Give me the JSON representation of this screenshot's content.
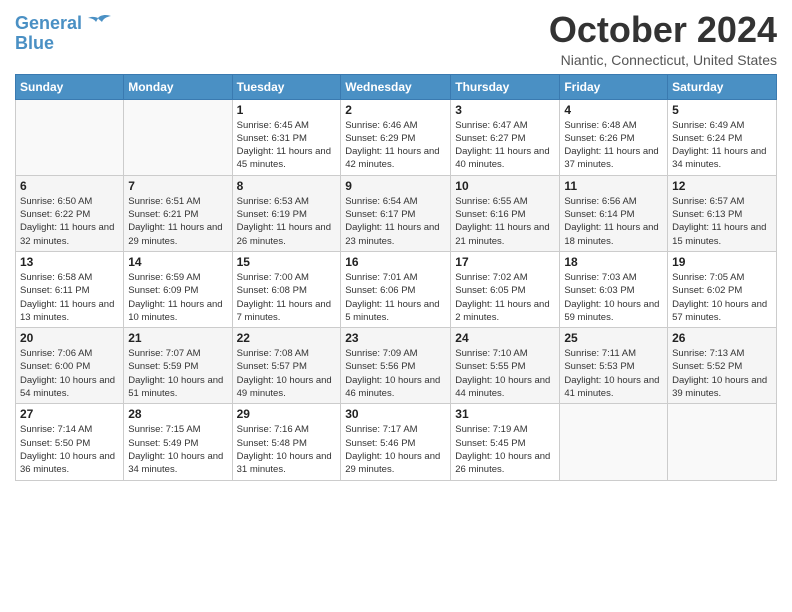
{
  "header": {
    "logo_line1": "General",
    "logo_line2": "Blue",
    "month_title": "October 2024",
    "location": "Niantic, Connecticut, United States"
  },
  "days_of_week": [
    "Sunday",
    "Monday",
    "Tuesday",
    "Wednesday",
    "Thursday",
    "Friday",
    "Saturday"
  ],
  "weeks": [
    [
      {
        "day": "",
        "info": ""
      },
      {
        "day": "",
        "info": ""
      },
      {
        "day": "1",
        "info": "Sunrise: 6:45 AM\nSunset: 6:31 PM\nDaylight: 11 hours and 45 minutes."
      },
      {
        "day": "2",
        "info": "Sunrise: 6:46 AM\nSunset: 6:29 PM\nDaylight: 11 hours and 42 minutes."
      },
      {
        "day": "3",
        "info": "Sunrise: 6:47 AM\nSunset: 6:27 PM\nDaylight: 11 hours and 40 minutes."
      },
      {
        "day": "4",
        "info": "Sunrise: 6:48 AM\nSunset: 6:26 PM\nDaylight: 11 hours and 37 minutes."
      },
      {
        "day": "5",
        "info": "Sunrise: 6:49 AM\nSunset: 6:24 PM\nDaylight: 11 hours and 34 minutes."
      }
    ],
    [
      {
        "day": "6",
        "info": "Sunrise: 6:50 AM\nSunset: 6:22 PM\nDaylight: 11 hours and 32 minutes."
      },
      {
        "day": "7",
        "info": "Sunrise: 6:51 AM\nSunset: 6:21 PM\nDaylight: 11 hours and 29 minutes."
      },
      {
        "day": "8",
        "info": "Sunrise: 6:53 AM\nSunset: 6:19 PM\nDaylight: 11 hours and 26 minutes."
      },
      {
        "day": "9",
        "info": "Sunrise: 6:54 AM\nSunset: 6:17 PM\nDaylight: 11 hours and 23 minutes."
      },
      {
        "day": "10",
        "info": "Sunrise: 6:55 AM\nSunset: 6:16 PM\nDaylight: 11 hours and 21 minutes."
      },
      {
        "day": "11",
        "info": "Sunrise: 6:56 AM\nSunset: 6:14 PM\nDaylight: 11 hours and 18 minutes."
      },
      {
        "day": "12",
        "info": "Sunrise: 6:57 AM\nSunset: 6:13 PM\nDaylight: 11 hours and 15 minutes."
      }
    ],
    [
      {
        "day": "13",
        "info": "Sunrise: 6:58 AM\nSunset: 6:11 PM\nDaylight: 11 hours and 13 minutes."
      },
      {
        "day": "14",
        "info": "Sunrise: 6:59 AM\nSunset: 6:09 PM\nDaylight: 11 hours and 10 minutes."
      },
      {
        "day": "15",
        "info": "Sunrise: 7:00 AM\nSunset: 6:08 PM\nDaylight: 11 hours and 7 minutes."
      },
      {
        "day": "16",
        "info": "Sunrise: 7:01 AM\nSunset: 6:06 PM\nDaylight: 11 hours and 5 minutes."
      },
      {
        "day": "17",
        "info": "Sunrise: 7:02 AM\nSunset: 6:05 PM\nDaylight: 11 hours and 2 minutes."
      },
      {
        "day": "18",
        "info": "Sunrise: 7:03 AM\nSunset: 6:03 PM\nDaylight: 10 hours and 59 minutes."
      },
      {
        "day": "19",
        "info": "Sunrise: 7:05 AM\nSunset: 6:02 PM\nDaylight: 10 hours and 57 minutes."
      }
    ],
    [
      {
        "day": "20",
        "info": "Sunrise: 7:06 AM\nSunset: 6:00 PM\nDaylight: 10 hours and 54 minutes."
      },
      {
        "day": "21",
        "info": "Sunrise: 7:07 AM\nSunset: 5:59 PM\nDaylight: 10 hours and 51 minutes."
      },
      {
        "day": "22",
        "info": "Sunrise: 7:08 AM\nSunset: 5:57 PM\nDaylight: 10 hours and 49 minutes."
      },
      {
        "day": "23",
        "info": "Sunrise: 7:09 AM\nSunset: 5:56 PM\nDaylight: 10 hours and 46 minutes."
      },
      {
        "day": "24",
        "info": "Sunrise: 7:10 AM\nSunset: 5:55 PM\nDaylight: 10 hours and 44 minutes."
      },
      {
        "day": "25",
        "info": "Sunrise: 7:11 AM\nSunset: 5:53 PM\nDaylight: 10 hours and 41 minutes."
      },
      {
        "day": "26",
        "info": "Sunrise: 7:13 AM\nSunset: 5:52 PM\nDaylight: 10 hours and 39 minutes."
      }
    ],
    [
      {
        "day": "27",
        "info": "Sunrise: 7:14 AM\nSunset: 5:50 PM\nDaylight: 10 hours and 36 minutes."
      },
      {
        "day": "28",
        "info": "Sunrise: 7:15 AM\nSunset: 5:49 PM\nDaylight: 10 hours and 34 minutes."
      },
      {
        "day": "29",
        "info": "Sunrise: 7:16 AM\nSunset: 5:48 PM\nDaylight: 10 hours and 31 minutes."
      },
      {
        "day": "30",
        "info": "Sunrise: 7:17 AM\nSunset: 5:46 PM\nDaylight: 10 hours and 29 minutes."
      },
      {
        "day": "31",
        "info": "Sunrise: 7:19 AM\nSunset: 5:45 PM\nDaylight: 10 hours and 26 minutes."
      },
      {
        "day": "",
        "info": ""
      },
      {
        "day": "",
        "info": ""
      }
    ]
  ]
}
